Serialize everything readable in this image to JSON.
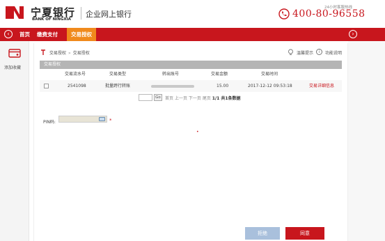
{
  "header": {
    "brand_name": "宁夏银行",
    "brand_en": "BANK OF NINGXIA",
    "brand_sub": "企业网上银行",
    "hotline_label": "24小时客服热线",
    "phone": "400-80-96558"
  },
  "nav": {
    "items": [
      {
        "label": "首页",
        "active": false
      },
      {
        "label": "缴费支付",
        "active": false
      },
      {
        "label": "交易授权",
        "active": true
      }
    ]
  },
  "sidebar": {
    "favorite_label": "添加收藏"
  },
  "breadcrumb": {
    "items": [
      "交易授权",
      "交易授权"
    ],
    "separator": "»"
  },
  "toolbar": {
    "tip_label": "温馨提示",
    "help_label": "功能说明"
  },
  "panel": {
    "title": "交易授权",
    "columns": [
      "交易流水号",
      "交易类型",
      "转出账号",
      "交易金额",
      "交易时间"
    ],
    "rows": [
      {
        "serial": "2541098",
        "type": "批量跨行转账",
        "account": "",
        "amount": "15.00",
        "time": "2017-12-12 09:53:18",
        "action": "交易详细信息"
      }
    ]
  },
  "pager": {
    "go_label": "Go",
    "first": "首页",
    "prev": "上一页",
    "next": "下一页",
    "last": "尾页",
    "summary": "1/1 共1条数据"
  },
  "form": {
    "pin_label": "PIN码:",
    "required_mark": "*"
  },
  "buttons": {
    "refuse": "拒绝",
    "agree": "同意"
  },
  "colors": {
    "brand_red": "#c8161d",
    "active_tab": "#f08a1c",
    "refuse_button": "#a9c0dc"
  }
}
